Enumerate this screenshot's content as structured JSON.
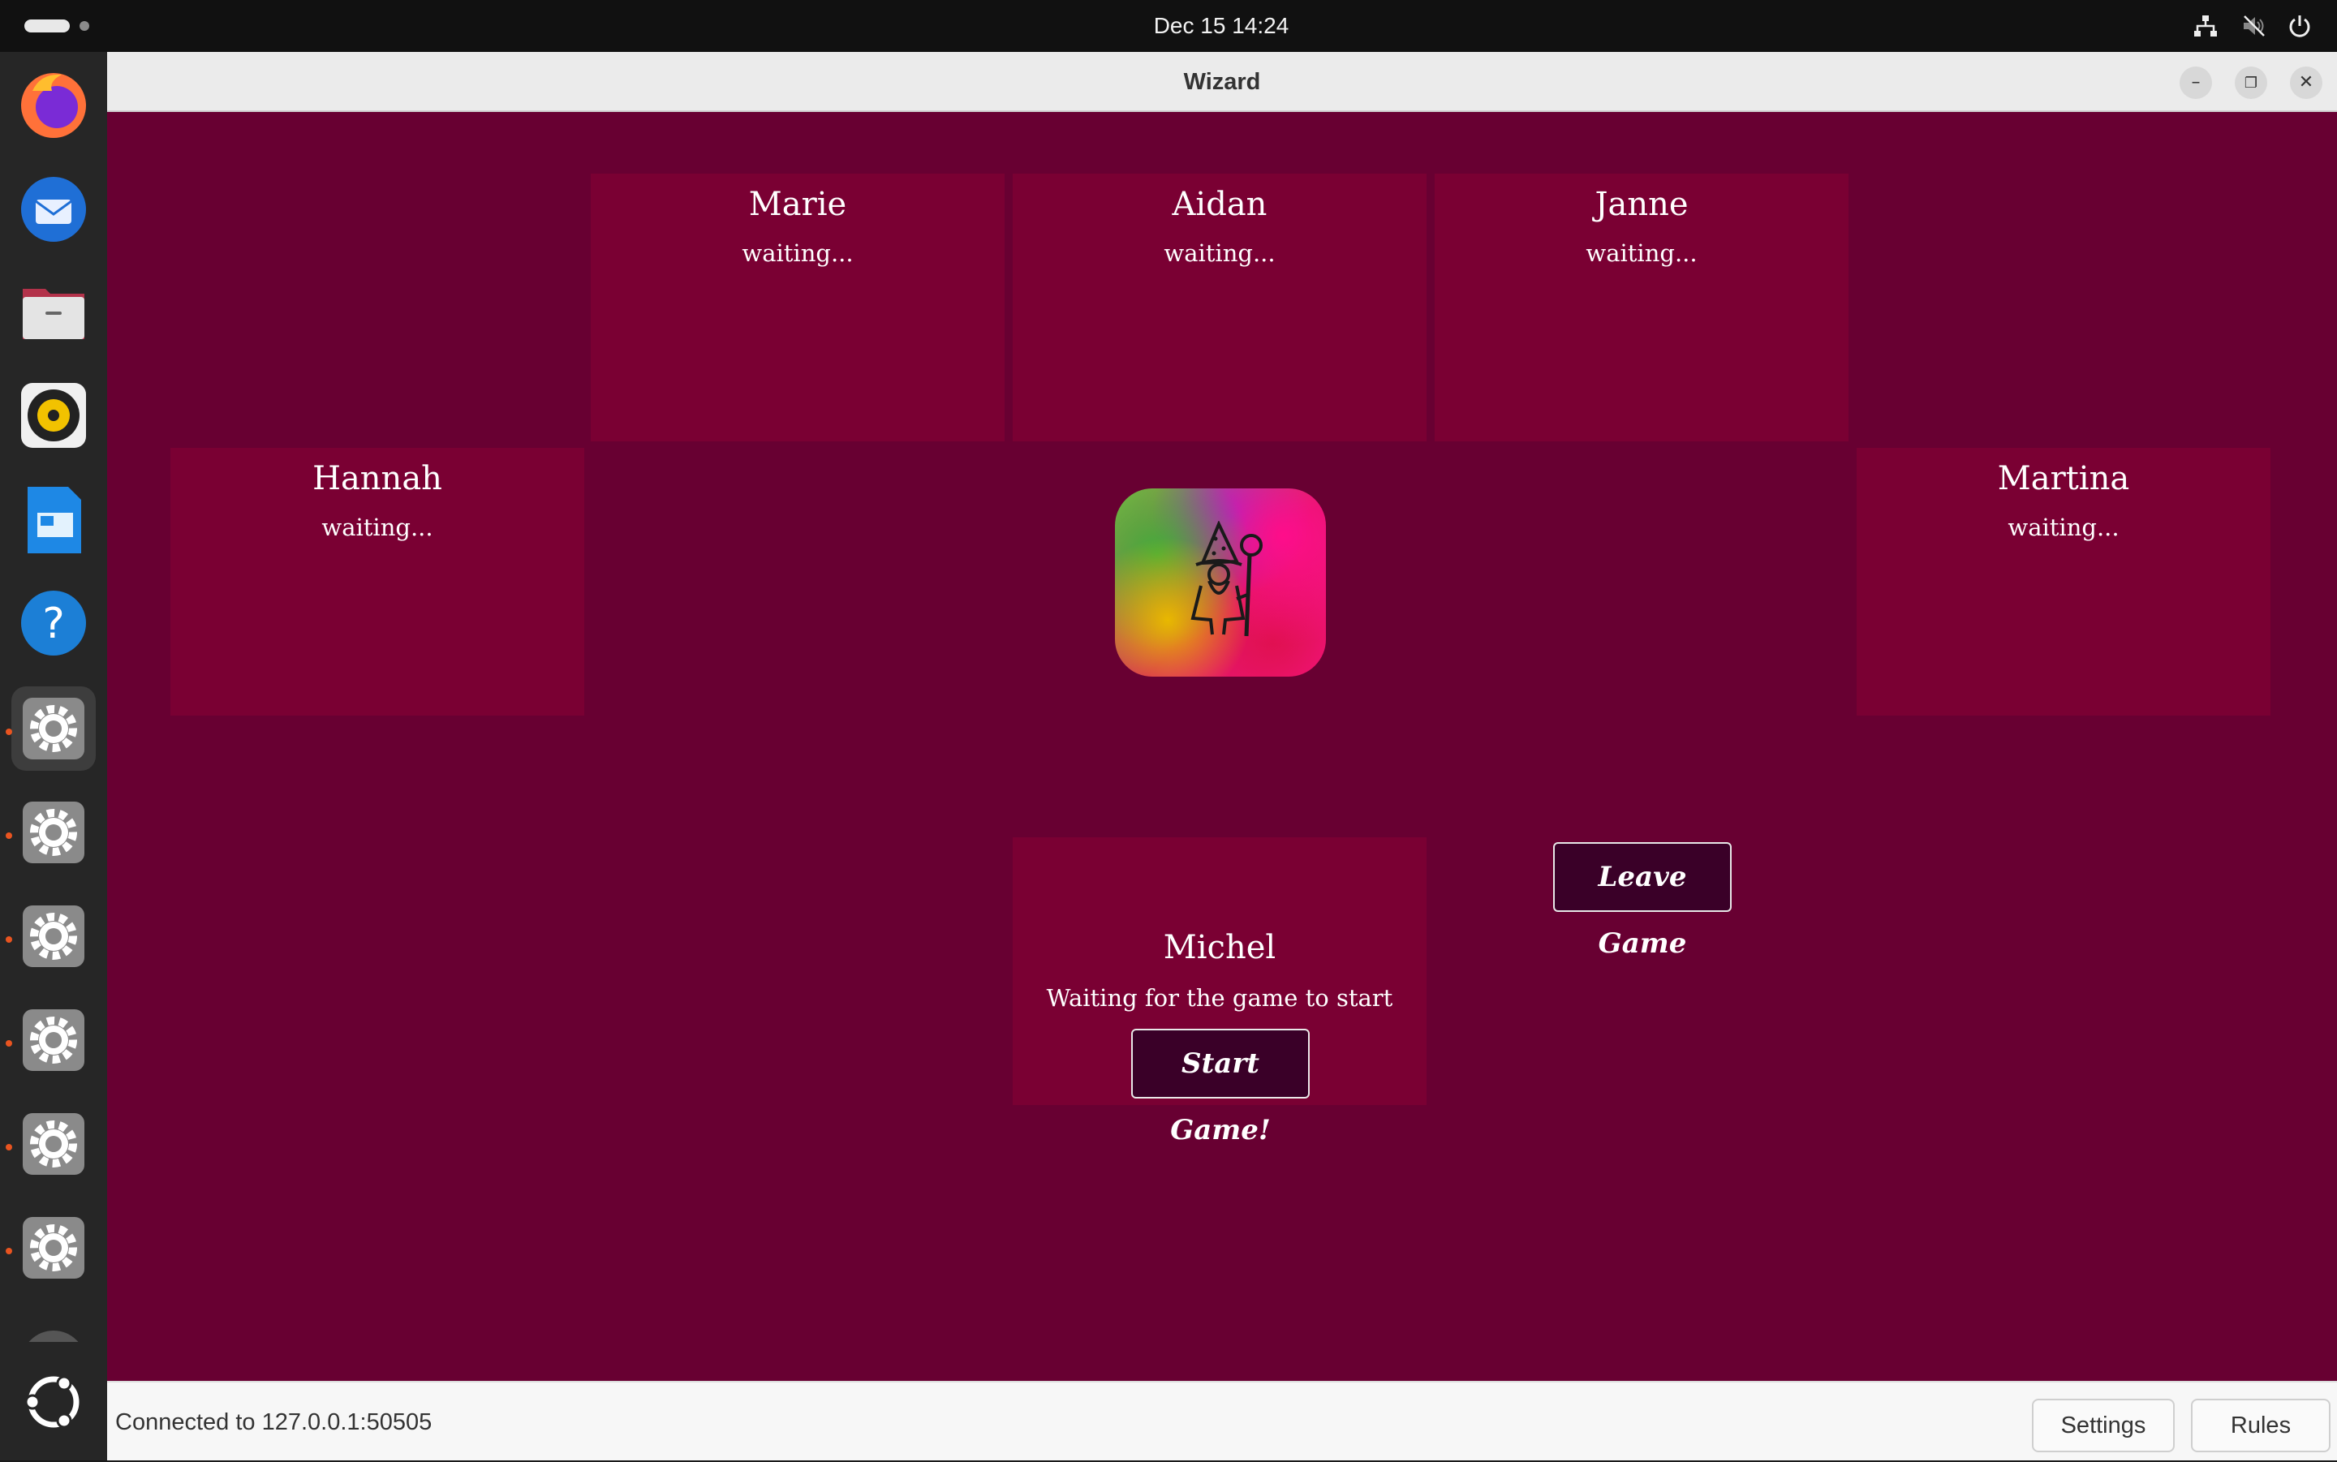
{
  "topbar": {
    "clock": "Dec 15  14:24",
    "tray_icons": [
      "network-icon",
      "speaker-muted-icon",
      "power-icon"
    ]
  },
  "dock": {
    "items": [
      {
        "name": "firefox",
        "icon": "firefox-icon"
      },
      {
        "name": "thunderbird",
        "icon": "thunderbird-icon"
      },
      {
        "name": "files",
        "icon": "folder-icon"
      },
      {
        "name": "rhythmbox",
        "icon": "speaker-icon"
      },
      {
        "name": "writer",
        "icon": "writer-icon"
      },
      {
        "name": "help",
        "icon": "help-icon"
      },
      {
        "name": "app-1",
        "icon": "gear-icon",
        "running": true,
        "active": true
      },
      {
        "name": "app-2",
        "icon": "gear-icon",
        "running": true
      },
      {
        "name": "app-3",
        "icon": "gear-icon",
        "running": true
      },
      {
        "name": "app-4",
        "icon": "gear-icon",
        "running": true
      },
      {
        "name": "app-5",
        "icon": "gear-icon",
        "running": true
      },
      {
        "name": "app-6",
        "icon": "gear-icon",
        "running": true
      }
    ],
    "bottom": "ubuntu-logo-icon"
  },
  "window": {
    "title": "Wizard",
    "controls": [
      "minimize-icon",
      "maximize-icon",
      "close-icon"
    ]
  },
  "game": {
    "background": "#680032",
    "panel_color": "#7a0033",
    "players": {
      "marie": {
        "name": "Marie",
        "status": "waiting..."
      },
      "aidan": {
        "name": "Aidan",
        "status": "waiting..."
      },
      "janne": {
        "name": "Janne",
        "status": "waiting..."
      },
      "hannah": {
        "name": "Hannah",
        "status": "waiting..."
      },
      "martina": {
        "name": "Martina",
        "status": "waiting..."
      }
    },
    "me": {
      "name": "Michel",
      "status": "Waiting for the game to start",
      "start_label": "Start Game!"
    },
    "leave_label": "Leave Game"
  },
  "statusbar": {
    "connection": "Connected to 127.0.0.1:50505",
    "settings_label": "Settings",
    "rules_label": "Rules"
  }
}
